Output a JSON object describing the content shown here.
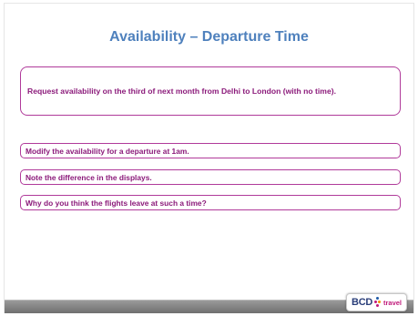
{
  "slide": {
    "title": "Availability – Departure Time",
    "main_instruction": "Request availability on the third of next month from Delhi to London  (with no time).",
    "steps": [
      "Modify the availability for a departure  at 1am.",
      "Note the difference in the displays.",
      "Why do you think the flights leave at such a time?"
    ]
  },
  "logo": {
    "brand": "BCD",
    "suffix": "travel",
    "colors": {
      "brand_text": "#2a3e7a",
      "suffix_text": "#c0197a",
      "dot_blue": "#1f5aa6",
      "dot_magenta": "#c0197a",
      "dot_orange": "#f39200"
    }
  },
  "colors": {
    "title": "#4f81bd",
    "box_border": "#b03a9a",
    "box_text": "#8b1a7a",
    "footer_bar": "#7a7a7a"
  }
}
